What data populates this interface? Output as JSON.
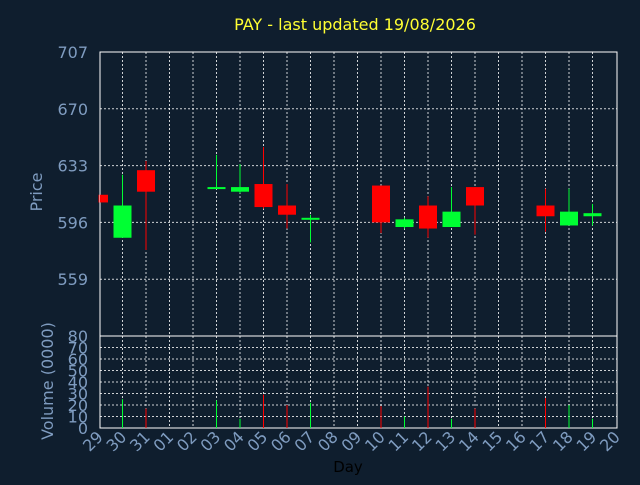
{
  "chart_data": {
    "type": "candlestick",
    "title": "PAY - last updated 19/08/2026",
    "xlabel": "Day",
    "price_ylabel": "Price",
    "volume_ylabel": "Volume (0000)",
    "x_categories": [
      "29",
      "30",
      "31",
      "01",
      "02",
      "03",
      "04",
      "05",
      "06",
      "07",
      "08",
      "09",
      "10",
      "11",
      "12",
      "13",
      "14",
      "15",
      "16",
      "17",
      "18",
      "19",
      "20"
    ],
    "price_yticks": [
      "707",
      "670",
      "633",
      "596",
      "559"
    ],
    "price_ticks_values": [
      707,
      670,
      633,
      596,
      559
    ],
    "price_ylim": [
      522,
      707
    ],
    "volume_yticks": [
      "80",
      "70",
      "60",
      "50",
      "40",
      "30",
      "20",
      "10",
      "0"
    ],
    "volume_ticks_values": [
      80,
      70,
      60,
      50,
      40,
      30,
      20,
      10,
      0
    ],
    "volume_ylim": [
      0,
      80
    ],
    "grid": true,
    "colors": {
      "up": "#00ff33",
      "down": "#ff0000",
      "background": "#0f1e2e",
      "title": "#ffff33",
      "axis_text": "#7f9cc0",
      "grid": "#ffffff"
    },
    "candles": [
      {
        "day": "29",
        "open": 614,
        "high": 614,
        "low": 609,
        "close": 609,
        "volume": 0
      },
      {
        "day": "30",
        "open": 586,
        "high": 627,
        "low": 586,
        "close": 607,
        "volume": 25
      },
      {
        "day": "31",
        "open": 630,
        "high": 636,
        "low": 578,
        "close": 616,
        "volume": 17
      },
      {
        "day": "03",
        "open": 618,
        "high": 640,
        "low": 618,
        "close": 619,
        "volume": 24
      },
      {
        "day": "04",
        "open": 616,
        "high": 634,
        "low": 615,
        "close": 619,
        "volume": 8
      },
      {
        "day": "05",
        "open": 621,
        "high": 645,
        "low": 605,
        "close": 606,
        "volume": 29
      },
      {
        "day": "06",
        "open": 607,
        "high": 621,
        "low": 592,
        "close": 601,
        "volume": 20
      },
      {
        "day": "07",
        "open": 598,
        "high": 601,
        "low": 583,
        "close": 599,
        "volume": 22
      },
      {
        "day": "10",
        "open": 620,
        "high": 620,
        "low": 589,
        "close": 596,
        "volume": 19
      },
      {
        "day": "11",
        "open": 593,
        "high": 599,
        "low": 592,
        "close": 598,
        "volume": 10
      },
      {
        "day": "12",
        "open": 607,
        "high": 613,
        "low": 586,
        "close": 592,
        "volume": 36
      },
      {
        "day": "13",
        "open": 593,
        "high": 619,
        "low": 593,
        "close": 603,
        "volume": 8
      },
      {
        "day": "14",
        "open": 619,
        "high": 619,
        "low": 588,
        "close": 607,
        "volume": 17
      },
      {
        "day": "17",
        "open": 607,
        "high": 618,
        "low": 590,
        "close": 600,
        "volume": 26
      },
      {
        "day": "18",
        "open": 594,
        "high": 618,
        "low": 594,
        "close": 603,
        "volume": 20
      },
      {
        "day": "19",
        "open": 600,
        "high": 608,
        "low": 594,
        "close": 602,
        "volume": 8
      }
    ]
  }
}
